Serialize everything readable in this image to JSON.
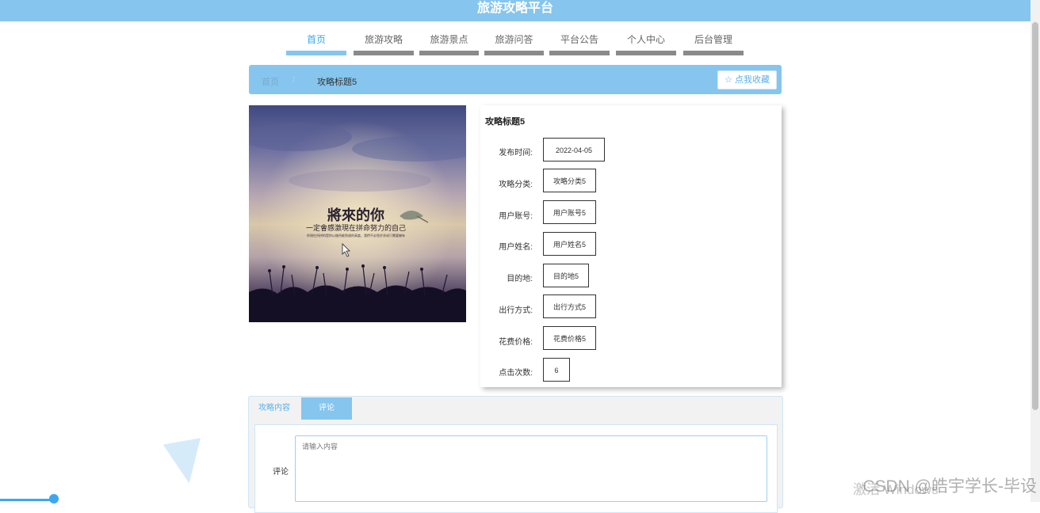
{
  "header": {
    "title": "旅游攻略平台"
  },
  "nav": {
    "items": [
      {
        "label": "首页",
        "active": true
      },
      {
        "label": "旅游攻略"
      },
      {
        "label": "旅游景点"
      },
      {
        "label": "旅游问答"
      },
      {
        "label": "平台公告"
      },
      {
        "label": "个人中心"
      },
      {
        "label": "后台管理"
      }
    ]
  },
  "breadcrumb": {
    "home": "首页",
    "separator": "/",
    "current": "攻略标题5"
  },
  "favorite": {
    "icon": "star-outline-icon",
    "label": "☆ 点我收藏"
  },
  "cover": {
    "title": "將來的你",
    "subtitle": "一定會感激現在拼命努力的自己",
    "small_text": "你現在所拼的是你以後所能到達的高度，我們不必急於求成只需要擁有"
  },
  "detail": {
    "title": "攻略标题5",
    "fields": [
      {
        "label": "发布时间:",
        "value": "2022-04-05"
      },
      {
        "label": "攻略分类:",
        "value": "攻略分类5"
      },
      {
        "label": "用户账号:",
        "value": "用户账号5"
      },
      {
        "label": "用户姓名:",
        "value": "用户姓名5"
      },
      {
        "label": "目的地:",
        "value": "目的地5"
      },
      {
        "label": "出行方式:",
        "value": "出行方式5"
      },
      {
        "label": "花费价格:",
        "value": "花费价格5"
      },
      {
        "label": "点击次数:",
        "value": "6"
      }
    ]
  },
  "tabs": {
    "content_label": "攻略内容",
    "comment_label": "评论",
    "active": "评论"
  },
  "comment": {
    "label": "评论",
    "placeholder": "请输入内容",
    "value": ""
  },
  "overlay": {
    "activate": "激活 Windows",
    "watermark": "CSDN @皓宇学长-毕设"
  },
  "colors": {
    "primary": "#85c5ee",
    "accent": "#3ba7f0"
  }
}
